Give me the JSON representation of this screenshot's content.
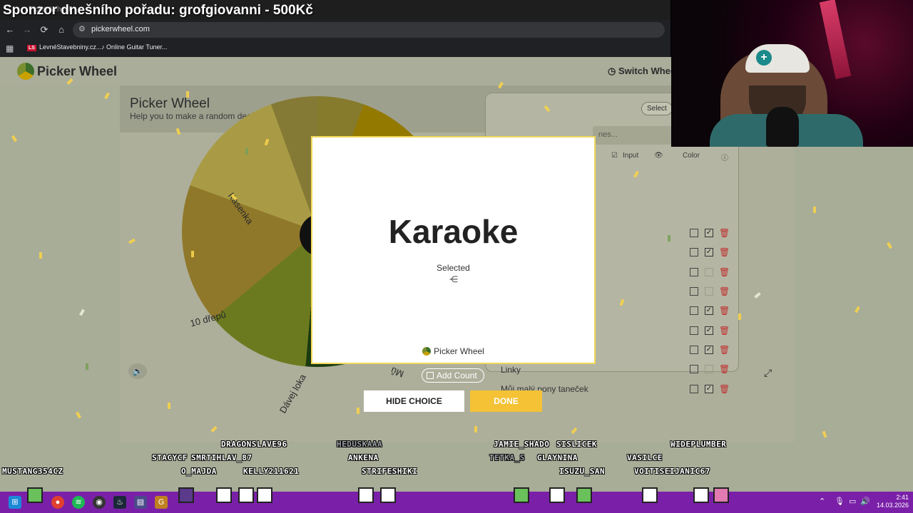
{
  "stream": {
    "sponsor_text": "Sponzor dnešního pořadu: grofgiovanni - 500Kč"
  },
  "browser": {
    "tab_title": "Picker Wheel",
    "url": "pickerwheel.com",
    "bookmarks": [
      {
        "badge": "LS",
        "label": "LevnéStavebniny.cz..."
      },
      {
        "label": "Online Guitar Tuner..."
      }
    ]
  },
  "site": {
    "logo_text": "Picker Wheel",
    "switch_label": "Switch Whee",
    "title": "Picker Wheel",
    "subtitle": "Help you to make a random decision"
  },
  "wheel": {
    "labels": [
      "Kasenka",
      "10 dřepů",
      "Dávej loka",
      "Mů"
    ]
  },
  "list_panel": {
    "select_label": "Select",
    "input_placeholder": "nes...",
    "col_input": "Input",
    "col_color": "Color",
    "rows": [
      {
        "label": "",
        "checked": true
      },
      {
        "label": "",
        "checked": true
      },
      {
        "label": "",
        "checked": false
      },
      {
        "label": "",
        "checked": false
      },
      {
        "label": "",
        "checked": true
      },
      {
        "label": "",
        "checked": true
      },
      {
        "label": "",
        "checked": true
      },
      {
        "label": "Linky",
        "checked": false
      },
      {
        "label": "Můj malý pony taneček",
        "checked": true
      }
    ]
  },
  "modal": {
    "result": "Karaoke",
    "selected_label": "Selected",
    "brand": "Picker Wheel",
    "add_count_label": "Add Count",
    "hide_label": "HIDE CHOICE",
    "done_label": "DONE"
  },
  "chat_names": [
    {
      "name": "DRAGONSLAVE96",
      "faded": false
    },
    {
      "name": "HEDUSKAAA",
      "faded": true
    },
    {
      "name": "JAMIE_SHADO",
      "faded": false
    },
    {
      "name": "SISLICEK",
      "faded": false
    },
    {
      "name": "WIDEPLUMBER",
      "faded": false
    },
    {
      "name": "STACYCF",
      "faded": false
    },
    {
      "name": "SMRTIHLAV_87",
      "faded": false
    },
    {
      "name": "ANKENA",
      "faded": false
    },
    {
      "name": "TETKA_S",
      "faded": true
    },
    {
      "name": "GLAYNINA",
      "faded": false
    },
    {
      "name": "VASILCE",
      "faded": false
    },
    {
      "name": "MUSTANG354CZ",
      "faded": false
    },
    {
      "name": "O_MAJDA",
      "faded": false
    },
    {
      "name": "KELLY211621",
      "faded": false
    },
    {
      "name": "STRIFESHIKI",
      "faded": false
    },
    {
      "name": "ISUZU_SAN",
      "faded": false
    },
    {
      "name": "VOITISEIJANIC67",
      "faded": false
    }
  ],
  "taskbar": {
    "time": "2:41",
    "date": "14.03.2026"
  },
  "colors": {
    "done_button": "#f4c234",
    "taskbar": "#7a20a8",
    "modal_border": "#f0d85a"
  }
}
